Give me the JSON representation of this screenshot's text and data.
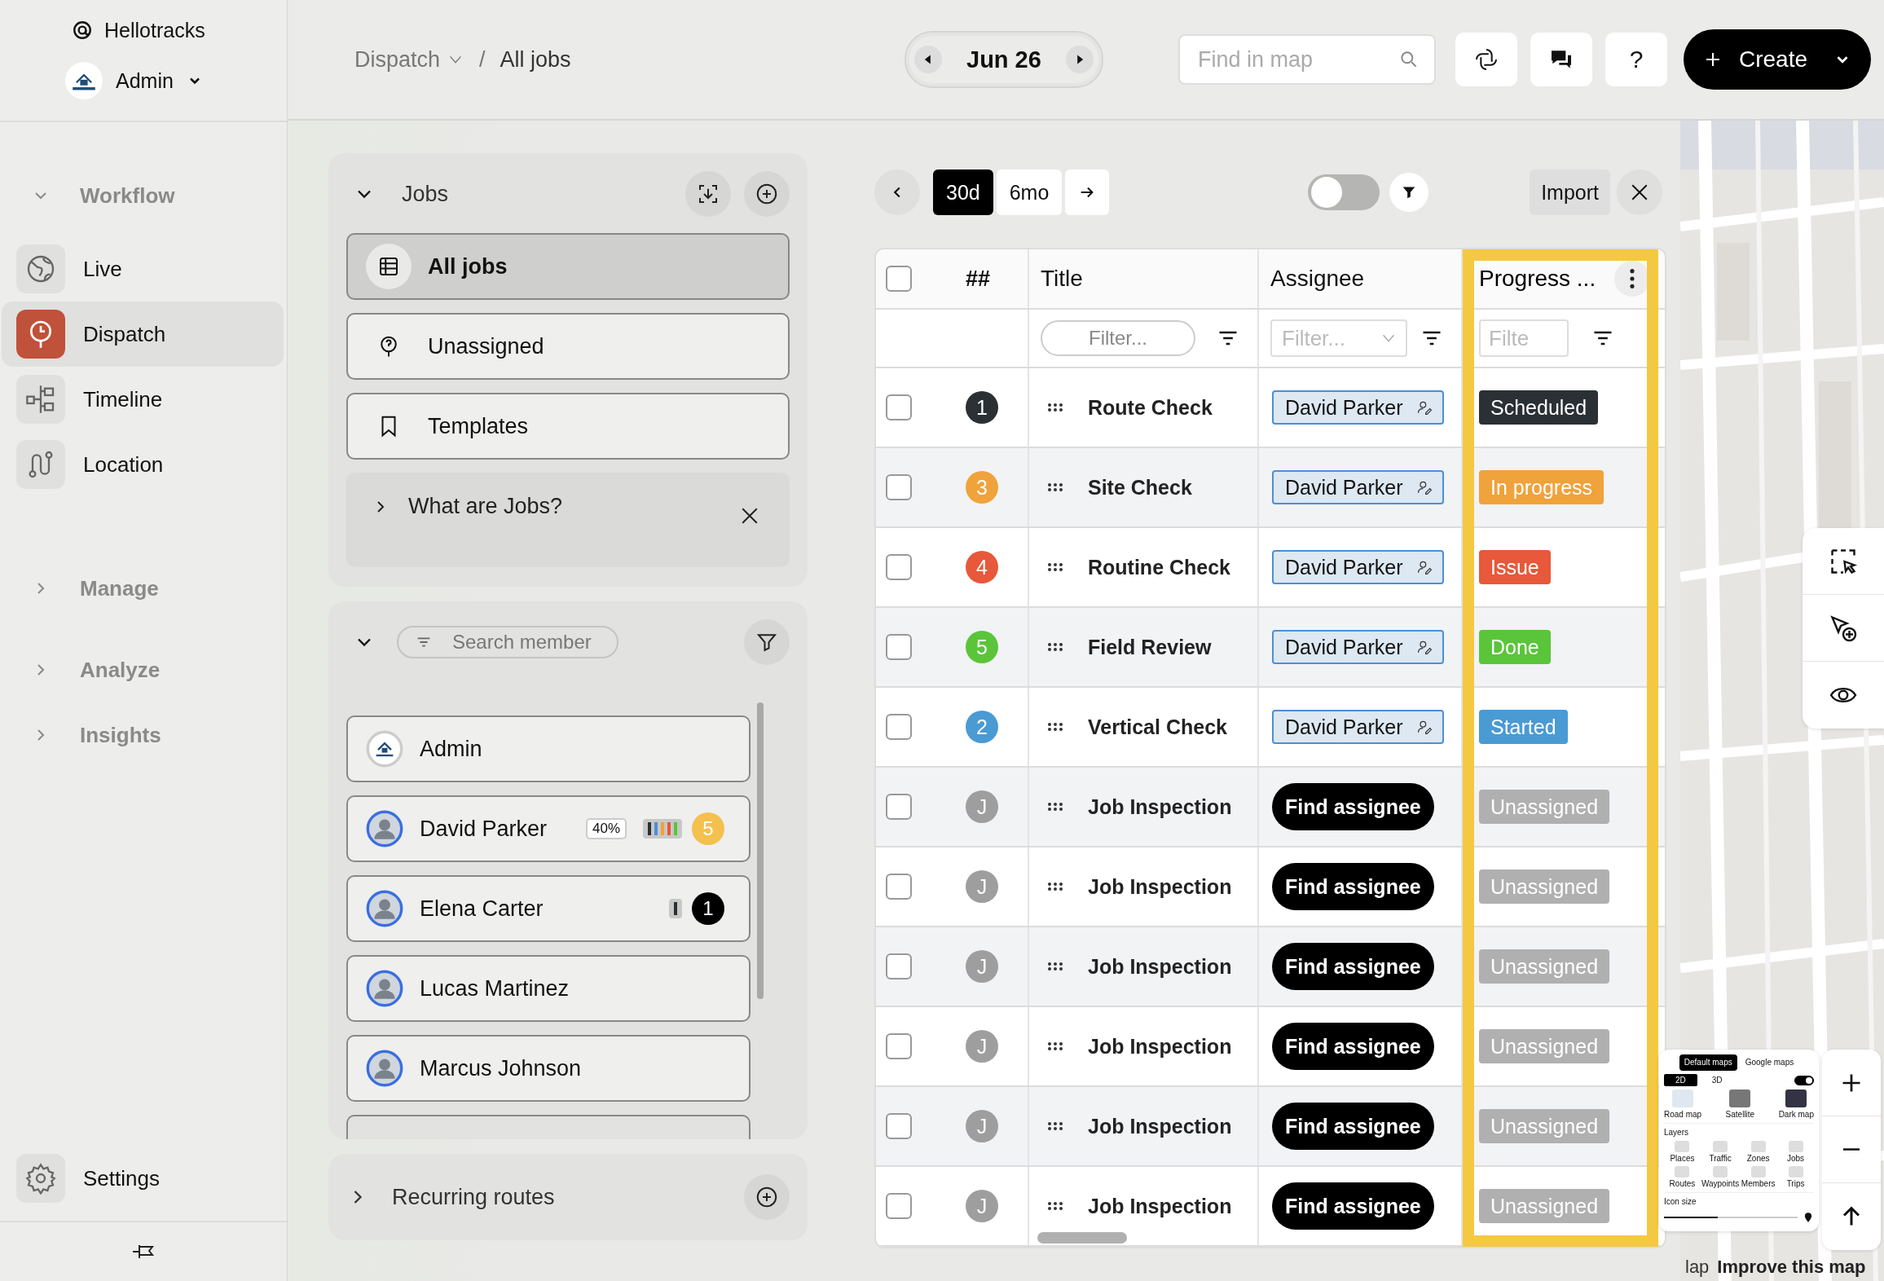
{
  "sidebar": {
    "brand": "Hellotracks",
    "account": "Admin",
    "sections": [
      {
        "label": "Workflow",
        "expanded": true,
        "items": [
          {
            "label": "Live",
            "selected": false
          },
          {
            "label": "Dispatch",
            "selected": true
          },
          {
            "label": "Timeline",
            "selected": false
          },
          {
            "label": "Location",
            "selected": false
          }
        ]
      },
      {
        "label": "Manage",
        "expanded": false
      },
      {
        "label": "Analyze",
        "expanded": false
      },
      {
        "label": "Insights",
        "expanded": false
      }
    ],
    "settings": "Settings"
  },
  "header": {
    "breadcrumb": {
      "parent": "Dispatch",
      "separator": "/",
      "current": "All jobs"
    },
    "date": "Jun 26",
    "search": {
      "placeholder": "Find in map"
    },
    "help": "?",
    "create": "Create"
  },
  "jobs_panel": {
    "title": "Jobs",
    "expanded": true,
    "views": [
      {
        "label": "All jobs",
        "selected": true
      },
      {
        "label": "Unassigned",
        "selected": false
      },
      {
        "label": "Templates",
        "selected": false
      }
    ],
    "info": {
      "label": "What are Jobs?",
      "expanded": false
    }
  },
  "members_panel": {
    "expanded": true,
    "search": {
      "placeholder": "Search member"
    },
    "members": [
      {
        "name": "Admin",
        "kind": "company"
      },
      {
        "name": "David Parker",
        "kind": "person",
        "utilization": "40%",
        "bars": [
          {
            "color": "#2b3035"
          },
          {
            "color": "#4a90d9"
          },
          {
            "color": "#f0a23b"
          },
          {
            "color": "#e8583a"
          },
          {
            "color": "#5ac53a"
          }
        ],
        "count": "5",
        "color": "#f4c04e"
      },
      {
        "name": "Elena Carter",
        "kind": "person",
        "bars": [
          {
            "color": "#2b3035"
          }
        ],
        "count": "1",
        "color": "#000000"
      },
      {
        "name": "Lucas Martinez",
        "kind": "person"
      },
      {
        "name": "Marcus Johnson",
        "kind": "person"
      }
    ]
  },
  "recurring_panel": {
    "title": "Recurring routes",
    "expanded": false
  },
  "toolbar": {
    "ranges": [
      {
        "label": "30d",
        "selected": true
      },
      {
        "label": "6mo",
        "selected": false
      }
    ],
    "toggle_on": false,
    "import": "Import"
  },
  "table": {
    "all_checked": false,
    "columns": [
      {
        "label": "##",
        "highlighted": false
      },
      {
        "label": "Title",
        "highlighted": false,
        "placeholder": "Filter..."
      },
      {
        "label": "Assignee",
        "highlighted": false,
        "placeholder": "Filter..."
      },
      {
        "label": "Progress ...",
        "highlighted": true,
        "placeholder": "Filte"
      }
    ],
    "rows": [
      {
        "checked": false,
        "number": "1",
        "color": "#2b3035",
        "title": "Route Check",
        "assignee": "David Parker",
        "status": {
          "label": "Scheduled",
          "color": "#2b3035"
        }
      },
      {
        "checked": false,
        "number": "3",
        "color": "#f0a23b",
        "title": "Site Check",
        "assignee": "David Parker",
        "status": {
          "label": "In progress",
          "color": "#f0a23b"
        }
      },
      {
        "checked": false,
        "number": "4",
        "color": "#e8583a",
        "title": "Routine Check",
        "assignee": "David Parker",
        "status": {
          "label": "Issue",
          "color": "#e8583a"
        }
      },
      {
        "checked": false,
        "number": "5",
        "color": "#5ac53a",
        "title": "Field Review",
        "assignee": "David Parker",
        "status": {
          "label": "Done",
          "color": "#5ac53a"
        }
      },
      {
        "checked": false,
        "number": "2",
        "color": "#4a9ad4",
        "title": "Vertical Check",
        "assignee": "David Parker",
        "status": {
          "label": "Started",
          "color": "#4a9ad4"
        }
      },
      {
        "checked": false,
        "number": "J",
        "color": "#9e9e9e",
        "title": "Job Inspection",
        "find_assignee": "Find assignee",
        "status": {
          "label": "Unassigned",
          "color": "#b0b0b0"
        }
      },
      {
        "checked": false,
        "number": "J",
        "color": "#9e9e9e",
        "title": "Job Inspection",
        "find_assignee": "Find assignee",
        "status": {
          "label": "Unassigned",
          "color": "#b0b0b0"
        }
      },
      {
        "checked": false,
        "number": "J",
        "color": "#9e9e9e",
        "title": "Job Inspection",
        "find_assignee": "Find assignee",
        "status": {
          "label": "Unassigned",
          "color": "#b0b0b0"
        }
      },
      {
        "checked": false,
        "number": "J",
        "color": "#9e9e9e",
        "title": "Job Inspection",
        "find_assignee": "Find assignee",
        "status": {
          "label": "Unassigned",
          "color": "#b0b0b0"
        }
      },
      {
        "checked": false,
        "number": "J",
        "color": "#9e9e9e",
        "title": "Job Inspection",
        "find_assignee": "Find assignee",
        "status": {
          "label": "Unassigned",
          "color": "#b0b0b0"
        }
      },
      {
        "checked": false,
        "number": "J",
        "color": "#9e9e9e",
        "title": "Job Inspection",
        "find_assignee": "Find assignee",
        "status": {
          "label": "Unassigned",
          "color": "#b0b0b0"
        }
      }
    ]
  },
  "map": {
    "layers_panel": {
      "sources": [
        {
          "label": "Default maps",
          "selected": true
        },
        {
          "label": "Google maps",
          "selected": false
        }
      ],
      "modes": [
        {
          "label": "2D",
          "selected": true
        },
        {
          "label": "3D",
          "selected": false
        }
      ],
      "toggle_on": true,
      "styles": [
        {
          "label": "Road map",
          "selected": false
        },
        {
          "label": "Satellite",
          "selected": false
        },
        {
          "label": "Dark map",
          "selected": false
        }
      ],
      "layers_title": "Layers",
      "layers": [
        "Places",
        "Traffic",
        "Zones",
        "Jobs",
        "Routes",
        "Waypoints",
        "Members",
        "Trips"
      ],
      "icon_size": {
        "label": "Icon size",
        "level": 0.4
      }
    },
    "attribution": [
      "lap",
      "Improve this map"
    ]
  }
}
